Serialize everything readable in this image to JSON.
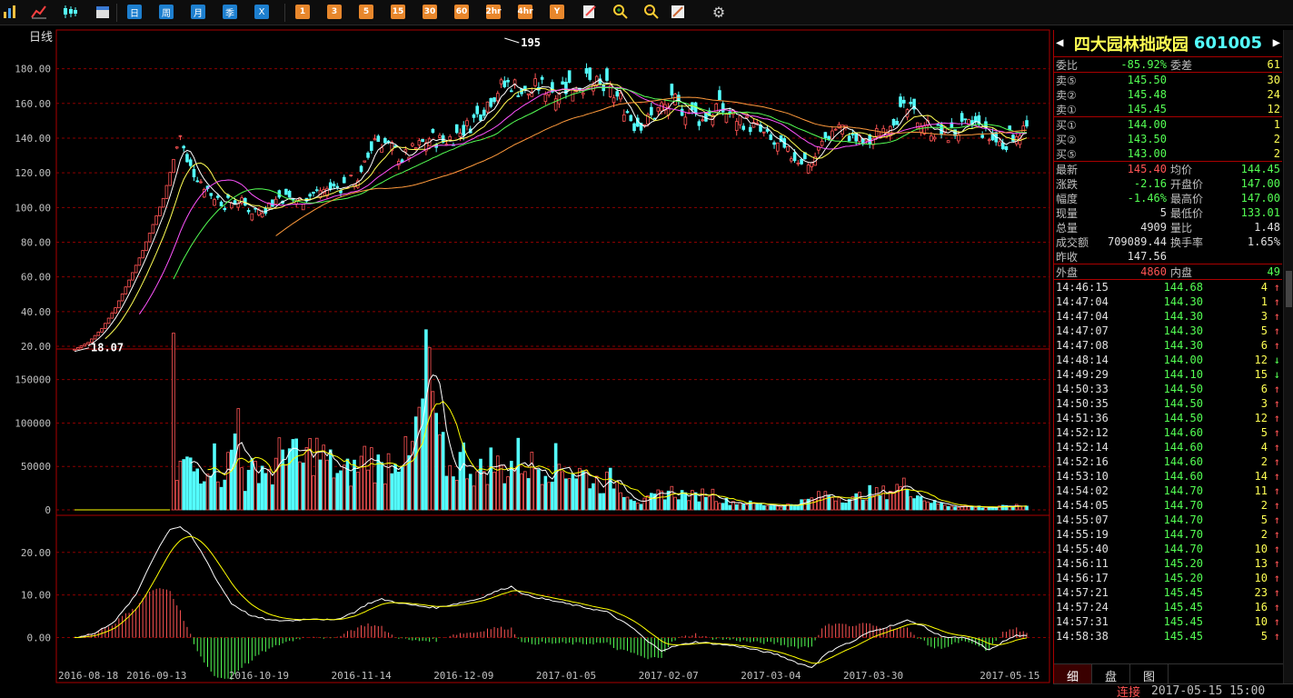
{
  "toolbar": {
    "icons": [
      "bar-chart-icon",
      "line-chart-icon",
      "candlestick-icon",
      "calendar-icon"
    ],
    "period_buttons": [
      "日",
      "周",
      "月",
      "季",
      "X"
    ],
    "minute_buttons": [
      "1",
      "3",
      "5",
      "15",
      "30",
      "60",
      "2hr",
      "4hr",
      "Y"
    ],
    "tool_icons": [
      "edit-icon",
      "zoom-in-icon",
      "zoom-out-icon",
      "draw-icon",
      "gear-icon"
    ]
  },
  "chart": {
    "period_label": "日线",
    "max_label": "195",
    "min_label": "18.07",
    "colors": {
      "up": "#ff5454",
      "down": "#54ffff",
      "grid": "#8b0000",
      "ma5": "#ffffff",
      "ma10": "#ffff54",
      "ma20": "#ff54ff",
      "ma30": "#54ff54",
      "ma60": "#ff9a3c"
    }
  },
  "chart_data": {
    "type": "candlestick",
    "price_ticks": [
      "180.00",
      "160.00",
      "140.00",
      "120.00",
      "100.00",
      "80.00",
      "60.00",
      "40.00",
      "20.00"
    ],
    "price_range": [
      20,
      195
    ],
    "volume_ticks": [
      "150000",
      "100000",
      "50000",
      "0"
    ],
    "volume_range": [
      0,
      180000
    ],
    "macd_ticks": [
      "20.00",
      "10.00",
      "0.00"
    ],
    "macd_range": [
      -8,
      27
    ],
    "dates": [
      "2016-08-18",
      "2016-09-13",
      "2016-10-19",
      "2016-11-14",
      "2016-12-09",
      "2017-01-05",
      "2017-02-07",
      "2017-03-04",
      "2017-03-30",
      "2017-05-15"
    ],
    "price_profile": [
      [
        0,
        18.07
      ],
      [
        4,
        22
      ],
      [
        8,
        30
      ],
      [
        12,
        42
      ],
      [
        16,
        58
      ],
      [
        20,
        75
      ],
      [
        24,
        95
      ],
      [
        26,
        105
      ],
      [
        28,
        120
      ],
      [
        30,
        135
      ],
      [
        31,
        142
      ],
      [
        33,
        125
      ],
      [
        36,
        118
      ],
      [
        40,
        108
      ],
      [
        44,
        102
      ],
      [
        48,
        104
      ],
      [
        52,
        98
      ],
      [
        56,
        100
      ],
      [
        60,
        106
      ],
      [
        66,
        104
      ],
      [
        72,
        110
      ],
      [
        78,
        112
      ],
      [
        84,
        118
      ],
      [
        88,
        140
      ],
      [
        92,
        136
      ],
      [
        96,
        128
      ],
      [
        100,
        134
      ],
      [
        104,
        140
      ],
      [
        108,
        138
      ],
      [
        112,
        142
      ],
      [
        116,
        148
      ],
      [
        120,
        158
      ],
      [
        124,
        168
      ],
      [
        128,
        172
      ],
      [
        132,
        165
      ],
      [
        136,
        170
      ],
      [
        140,
        168
      ],
      [
        144,
        170
      ],
      [
        150,
        172
      ],
      [
        156,
        168
      ],
      [
        160,
        162
      ],
      [
        164,
        148
      ],
      [
        168,
        150
      ],
      [
        172,
        158
      ],
      [
        176,
        160
      ],
      [
        180,
        155
      ],
      [
        184,
        150
      ],
      [
        188,
        158
      ],
      [
        192,
        154
      ],
      [
        196,
        150
      ],
      [
        200,
        145
      ],
      [
        204,
        138
      ],
      [
        208,
        132
      ],
      [
        212,
        128
      ],
      [
        216,
        126
      ],
      [
        220,
        140
      ],
      [
        224,
        148
      ],
      [
        228,
        140
      ],
      [
        232,
        136
      ],
      [
        236,
        144
      ],
      [
        240,
        152
      ],
      [
        244,
        156
      ],
      [
        248,
        150
      ],
      [
        252,
        144
      ],
      [
        256,
        142
      ],
      [
        260,
        145
      ],
      [
        264,
        148
      ],
      [
        268,
        140
      ],
      [
        272,
        136
      ],
      [
        276,
        144
      ],
      [
        279,
        145.4
      ]
    ],
    "volume_profile": [
      [
        0,
        0
      ],
      [
        28,
        0
      ],
      [
        29,
        145000
      ],
      [
        30,
        40000
      ],
      [
        32,
        55000
      ],
      [
        35,
        45000
      ],
      [
        38,
        50000
      ],
      [
        40,
        65000
      ],
      [
        43,
        40000
      ],
      [
        46,
        60000
      ],
      [
        48,
        115000
      ],
      [
        50,
        30000
      ],
      [
        54,
        55000
      ],
      [
        58,
        40000
      ],
      [
        62,
        80000
      ],
      [
        66,
        50000
      ],
      [
        70,
        70000
      ],
      [
        74,
        55000
      ],
      [
        78,
        40000
      ],
      [
        82,
        45000
      ],
      [
        86,
        65000
      ],
      [
        90,
        45000
      ],
      [
        94,
        70000
      ],
      [
        98,
        55000
      ],
      [
        102,
        120000
      ],
      [
        104,
        180000
      ],
      [
        106,
        80000
      ],
      [
        110,
        45000
      ],
      [
        114,
        60000
      ],
      [
        118,
        40000
      ],
      [
        122,
        55000
      ],
      [
        126,
        45000
      ],
      [
        130,
        60000
      ],
      [
        134,
        50000
      ],
      [
        140,
        55000
      ],
      [
        146,
        45000
      ],
      [
        150,
        40000
      ],
      [
        154,
        30000
      ],
      [
        158,
        35000
      ],
      [
        162,
        20000
      ],
      [
        166,
        8000
      ],
      [
        170,
        15000
      ],
      [
        174,
        22000
      ],
      [
        178,
        18000
      ],
      [
        182,
        15000
      ],
      [
        186,
        22000
      ],
      [
        190,
        10000
      ],
      [
        196,
        8000
      ],
      [
        202,
        6000
      ],
      [
        208,
        5000
      ],
      [
        212,
        8000
      ],
      [
        216,
        12000
      ],
      [
        220,
        18000
      ],
      [
        224,
        15000
      ],
      [
        228,
        12000
      ],
      [
        232,
        20000
      ],
      [
        236,
        18000
      ],
      [
        240,
        25000
      ],
      [
        244,
        28000
      ],
      [
        248,
        15000
      ],
      [
        252,
        8000
      ],
      [
        256,
        5000
      ],
      [
        262,
        4000
      ],
      [
        268,
        3000
      ],
      [
        274,
        4000
      ],
      [
        279,
        4909
      ]
    ],
    "macd_profile": [
      [
        0,
        0
      ],
      [
        6,
        1
      ],
      [
        12,
        4
      ],
      [
        18,
        10
      ],
      [
        22,
        17
      ],
      [
        26,
        23
      ],
      [
        28,
        25.5
      ],
      [
        31,
        26
      ],
      [
        34,
        24
      ],
      [
        38,
        19
      ],
      [
        42,
        13
      ],
      [
        46,
        8
      ],
      [
        52,
        5
      ],
      [
        58,
        4
      ],
      [
        64,
        4
      ],
      [
        70,
        4.5
      ],
      [
        76,
        4
      ],
      [
        82,
        6
      ],
      [
        86,
        8
      ],
      [
        90,
        9
      ],
      [
        96,
        8
      ],
      [
        100,
        7.5
      ],
      [
        106,
        7
      ],
      [
        112,
        8
      ],
      [
        118,
        9
      ],
      [
        124,
        11
      ],
      [
        128,
        12
      ],
      [
        132,
        10
      ],
      [
        138,
        9
      ],
      [
        144,
        8
      ],
      [
        150,
        7
      ],
      [
        156,
        6
      ],
      [
        160,
        4
      ],
      [
        164,
        2
      ],
      [
        168,
        -1
      ],
      [
        172,
        -3
      ],
      [
        176,
        -2
      ],
      [
        182,
        -1
      ],
      [
        188,
        -1.5
      ],
      [
        194,
        -2
      ],
      [
        200,
        -3
      ],
      [
        206,
        -4
      ],
      [
        212,
        -6
      ],
      [
        216,
        -7
      ],
      [
        220,
        -4
      ],
      [
        224,
        -2
      ],
      [
        228,
        -1
      ],
      [
        232,
        1
      ],
      [
        236,
        2
      ],
      [
        240,
        3
      ],
      [
        244,
        4
      ],
      [
        248,
        3
      ],
      [
        252,
        1
      ],
      [
        256,
        0
      ],
      [
        260,
        0
      ],
      [
        264,
        -1
      ],
      [
        268,
        -3
      ],
      [
        272,
        -1
      ],
      [
        276,
        0.5
      ],
      [
        279,
        0.3
      ]
    ]
  },
  "quote": {
    "name": "四大园林拙政园",
    "code": "601005",
    "weibi_label": "委比",
    "weibi": "-85.92%",
    "weicha_label": "委差",
    "weicha": "61",
    "asks": [
      {
        "label": "卖⑤",
        "price": "145.50",
        "vol": "30"
      },
      {
        "label": "卖②",
        "price": "145.48",
        "vol": "24"
      },
      {
        "label": "卖①",
        "price": "145.45",
        "vol": "12"
      }
    ],
    "bids": [
      {
        "label": "买①",
        "price": "144.00",
        "vol": "1"
      },
      {
        "label": "买②",
        "price": "143.50",
        "vol": "2"
      },
      {
        "label": "买⑤",
        "price": "143.00",
        "vol": "2"
      }
    ],
    "stats": [
      {
        "l1": "最新",
        "v1": "145.40",
        "c1": "red",
        "l2": "均价",
        "v2": "144.45",
        "c2": "green"
      },
      {
        "l1": "涨跌",
        "v1": "-2.16",
        "c1": "green",
        "l2": "开盘价",
        "v2": "147.00",
        "c2": "green"
      },
      {
        "l1": "幅度",
        "v1": "-1.46%",
        "c1": "green",
        "l2": "最高价",
        "v2": "147.00",
        "c2": "green"
      },
      {
        "l1": "现量",
        "v1": "5",
        "c1": "white",
        "l2": "最低价",
        "v2": "133.01",
        "c2": "green"
      },
      {
        "l1": "总量",
        "v1": "4909",
        "c1": "white",
        "l2": "量比",
        "v2": "1.48",
        "c2": "white"
      },
      {
        "l1": "成交额",
        "v1": "709089.44",
        "c1": "white",
        "l2": "换手率",
        "v2": "1.65%",
        "c2": "white"
      },
      {
        "l1": "昨收",
        "v1": "147.56",
        "c1": "white",
        "l2": "",
        "v2": "",
        "c2": "white"
      }
    ],
    "waipan_label": "外盘",
    "waipan": "4860",
    "neipan_label": "内盘",
    "neipan": "49"
  },
  "ticks": [
    {
      "time": "14:46:15",
      "price": "144.68",
      "vol": "4",
      "dir": "↑"
    },
    {
      "time": "14:47:04",
      "price": "144.30",
      "vol": "1",
      "dir": "↑"
    },
    {
      "time": "14:47:04",
      "price": "144.30",
      "vol": "3",
      "dir": "↑"
    },
    {
      "time": "14:47:07",
      "price": "144.30",
      "vol": "5",
      "dir": "↑"
    },
    {
      "time": "14:47:08",
      "price": "144.30",
      "vol": "6",
      "dir": "↑"
    },
    {
      "time": "14:48:14",
      "price": "144.00",
      "vol": "12",
      "dir": "↓"
    },
    {
      "time": "14:49:29",
      "price": "144.10",
      "vol": "15",
      "dir": "↓"
    },
    {
      "time": "14:50:33",
      "price": "144.50",
      "vol": "6",
      "dir": "↑"
    },
    {
      "time": "14:50:35",
      "price": "144.50",
      "vol": "3",
      "dir": "↑"
    },
    {
      "time": "14:51:36",
      "price": "144.50",
      "vol": "12",
      "dir": "↑"
    },
    {
      "time": "14:52:12",
      "price": "144.60",
      "vol": "5",
      "dir": "↑"
    },
    {
      "time": "14:52:14",
      "price": "144.60",
      "vol": "4",
      "dir": "↑"
    },
    {
      "time": "14:52:16",
      "price": "144.60",
      "vol": "2",
      "dir": "↑"
    },
    {
      "time": "14:53:10",
      "price": "144.60",
      "vol": "14",
      "dir": "↑"
    },
    {
      "time": "14:54:02",
      "price": "144.70",
      "vol": "11",
      "dir": "↑"
    },
    {
      "time": "14:54:05",
      "price": "144.70",
      "vol": "2",
      "dir": "↑"
    },
    {
      "time": "14:55:07",
      "price": "144.70",
      "vol": "5",
      "dir": "↑"
    },
    {
      "time": "14:55:19",
      "price": "144.70",
      "vol": "2",
      "dir": "↑"
    },
    {
      "time": "14:55:40",
      "price": "144.70",
      "vol": "10",
      "dir": "↑"
    },
    {
      "time": "14:56:11",
      "price": "145.20",
      "vol": "13",
      "dir": "↑"
    },
    {
      "time": "14:56:17",
      "price": "145.20",
      "vol": "10",
      "dir": "↑"
    },
    {
      "time": "14:57:21",
      "price": "145.45",
      "vol": "23",
      "dir": "↑"
    },
    {
      "time": "14:57:24",
      "price": "145.45",
      "vol": "16",
      "dir": "↑"
    },
    {
      "time": "14:57:31",
      "price": "145.45",
      "vol": "10",
      "dir": "↑"
    },
    {
      "time": "14:58:38",
      "price": "145.45",
      "vol": "5",
      "dir": "↑"
    }
  ],
  "tabs": [
    "细",
    "盘",
    "图"
  ],
  "status": {
    "connection": "连接",
    "datetime": "2017-05-15 15:00"
  }
}
